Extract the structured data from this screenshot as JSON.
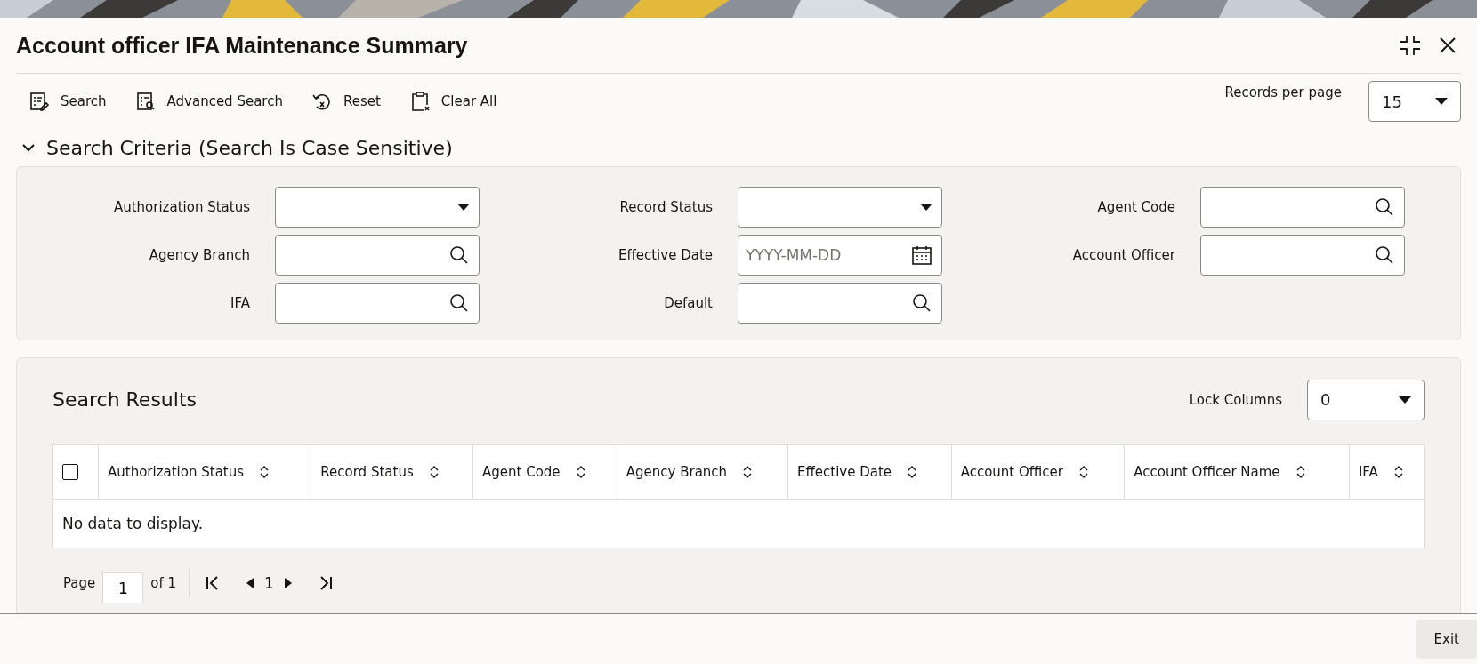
{
  "window": {
    "title": "Account officer IFA Maintenance Summary"
  },
  "toolbar": [
    {
      "kind": "search",
      "label": "Search"
    },
    {
      "kind": "advanced",
      "label": "Advanced Search"
    },
    {
      "kind": "reset",
      "label": "Reset"
    },
    {
      "kind": "clear",
      "label": "Clear All"
    }
  ],
  "records_per_page": {
    "label": "Records per page",
    "value": "15"
  },
  "search_criteria": {
    "title": "Search Criteria (Search Is Case Sensitive)",
    "expanded": true,
    "fields": [
      {
        "label": "Authorization Status",
        "kind": "select"
      },
      {
        "label": "Record Status",
        "kind": "select"
      },
      {
        "label": "Agent Code",
        "kind": "lookup"
      },
      {
        "label": "Agency Branch",
        "kind": "lookup"
      },
      {
        "label": "Effective Date",
        "kind": "date",
        "placeholder": "YYYY-MM-DD"
      },
      {
        "label": "Account Officer",
        "kind": "lookup"
      },
      {
        "label": "IFA",
        "kind": "lookup"
      },
      {
        "label": "Default",
        "kind": "lookup"
      }
    ]
  },
  "search_results": {
    "title": "Search Results",
    "lock_columns": {
      "label": "Lock Columns",
      "value": "0"
    },
    "table": {
      "select_all_checked": false,
      "columns": [
        "Authorization Status",
        "Record Status",
        "Agent Code",
        "Agency Branch",
        "Effective Date",
        "Account Officer",
        "Account Officer Name",
        "IFA"
      ],
      "empty_message": "No data to display."
    },
    "pager": {
      "page_label": "Page",
      "page": "1",
      "of_label": "of 1",
      "current": "1"
    }
  },
  "footer": {
    "buttons": [
      "Exit"
    ]
  }
}
